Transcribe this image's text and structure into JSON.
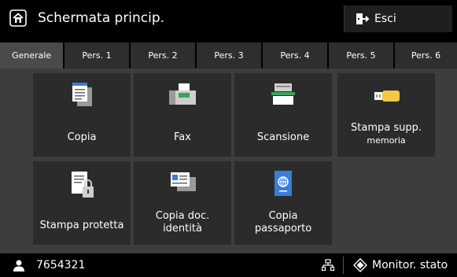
{
  "header": {
    "title": "Schermata princip.",
    "home_icon": "home-icon",
    "exit_label": "Esci",
    "exit_icon": "exit-icon"
  },
  "tabs": [
    {
      "label": "Generale",
      "active": true
    },
    {
      "label": "Pers. 1",
      "active": false
    },
    {
      "label": "Pers. 2",
      "active": false
    },
    {
      "label": "Pers. 3",
      "active": false
    },
    {
      "label": "Pers. 4",
      "active": false
    },
    {
      "label": "Pers. 5",
      "active": false
    },
    {
      "label": "Pers. 6",
      "active": false
    }
  ],
  "tiles": [
    {
      "label": "Copia",
      "icon": "copy-icon"
    },
    {
      "label": "Fax",
      "icon": "fax-icon"
    },
    {
      "label": "Scansione",
      "icon": "scan-icon"
    },
    {
      "label_line1": "Stampa supp.",
      "label_line2": "memoria",
      "icon": "usb-memory-icon"
    },
    {
      "label": "Stampa protetta",
      "icon": "secure-print-icon"
    },
    {
      "label_line1": "Copia doc.",
      "label_line2": "identità",
      "icon": "id-card-copy-icon"
    },
    {
      "label_line1": "Copia",
      "label_line2": "passaporto",
      "icon": "passport-copy-icon"
    }
  ],
  "status": {
    "user_id": "7654321",
    "user_icon": "user-icon",
    "network_icon": "network-icon",
    "monitor_label": "Monitor. stato",
    "monitor_icon": "status-monitor-icon"
  },
  "colors": {
    "background": "#000000",
    "panel": "#3d3d3d",
    "tile": "#2b2b2b",
    "accent_green": "#3aa35a",
    "accent_blue": "#3b7dd8",
    "usb_yellow": "#f2c744"
  }
}
